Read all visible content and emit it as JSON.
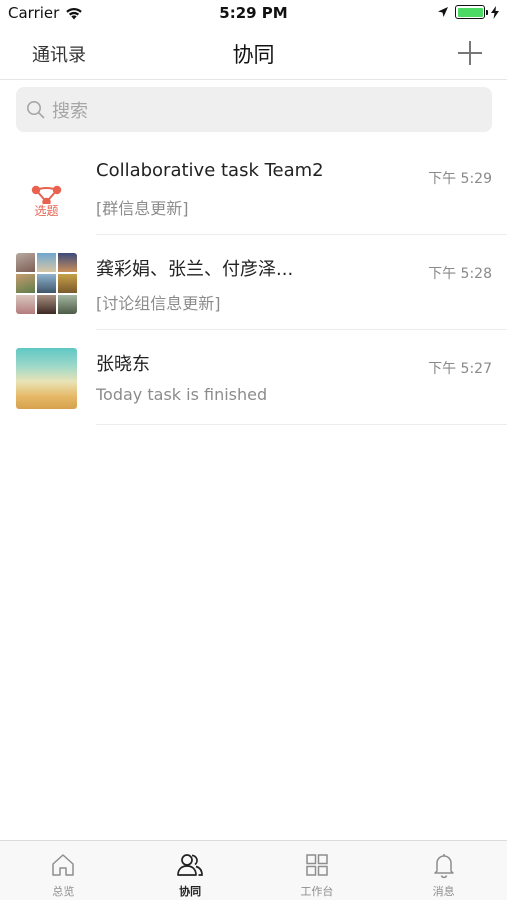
{
  "status_bar": {
    "carrier": "Carrier",
    "time": "5:29 PM",
    "battery_level": 1.0
  },
  "nav": {
    "left_label": "通讯录",
    "title": "协同",
    "add_icon": "plus-icon"
  },
  "search": {
    "placeholder": "搜索"
  },
  "conversations": [
    {
      "name": "Collaborative task Team2",
      "preview": "[群信息更新]",
      "time": "下午 5:29",
      "avatar_label": "选题",
      "avatar_type": "group-icon"
    },
    {
      "name": "龚彩娟、张兰、付彦泽...",
      "preview": "[讨论组信息更新]",
      "time": "下午 5:28",
      "avatar_type": "photo-grid"
    },
    {
      "name": "张晓东",
      "preview": "Today task is finished",
      "time": "下午 5:27",
      "avatar_type": "photo"
    }
  ],
  "tabs": [
    {
      "label": "总览",
      "icon": "home-icon",
      "active": false
    },
    {
      "label": "协同",
      "icon": "people-icon",
      "active": true
    },
    {
      "label": "工作台",
      "icon": "grid-icon",
      "active": false
    },
    {
      "label": "消息",
      "icon": "bell-icon",
      "active": false
    }
  ],
  "colors": {
    "accent": "#e8624f",
    "battery": "#4cd964",
    "search_bg": "#efefef"
  }
}
